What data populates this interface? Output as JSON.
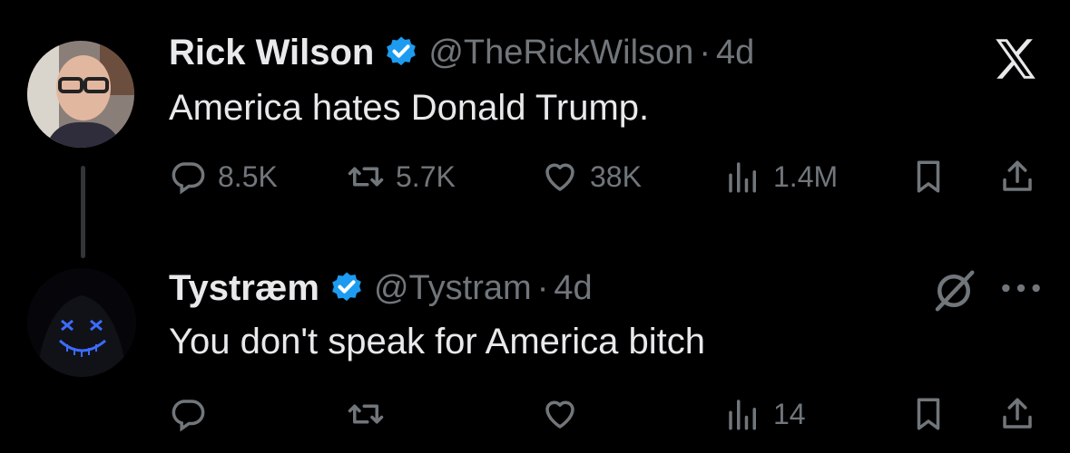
{
  "tweets": [
    {
      "name": "Rick Wilson",
      "handle": "@TheRickWilson",
      "separator": "·",
      "time": "4d",
      "text": "America hates Donald Trump.",
      "actions": {
        "replies": "8.5K",
        "reposts": "5.7K",
        "likes": "38K",
        "views": "1.4M"
      }
    },
    {
      "name": "Tystræm",
      "handle": "@Tystram",
      "separator": "·",
      "time": "4d",
      "text": "You don't speak for America bitch",
      "actions": {
        "replies": "",
        "reposts": "",
        "likes": "",
        "views": "14"
      }
    }
  ],
  "icons": {
    "reply": "reply-icon",
    "repost": "repost-icon",
    "like": "heart-icon",
    "views": "views-icon",
    "bookmark": "bookmark-icon",
    "share": "share-icon",
    "verified": "verified-badge-icon",
    "x_logo": "x-logo-icon",
    "grok": "grok-icon",
    "more": "more-icon"
  },
  "colors": {
    "background": "#000000",
    "text": "#e7e9ea",
    "muted": "#71767b",
    "verified": "#1d9bf0"
  }
}
